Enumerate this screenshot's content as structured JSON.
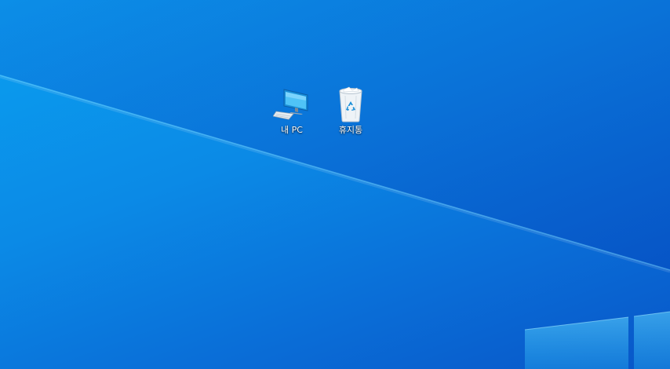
{
  "desktop": {
    "icons": [
      {
        "label": "내 PC",
        "icon": "computer-icon"
      },
      {
        "label": "휴지통",
        "icon": "recycle-bin-icon"
      }
    ]
  },
  "colors": {
    "background_light": "#0aa0f0",
    "background_dark": "#0856c8",
    "window_logo": "#3fc8ff"
  }
}
